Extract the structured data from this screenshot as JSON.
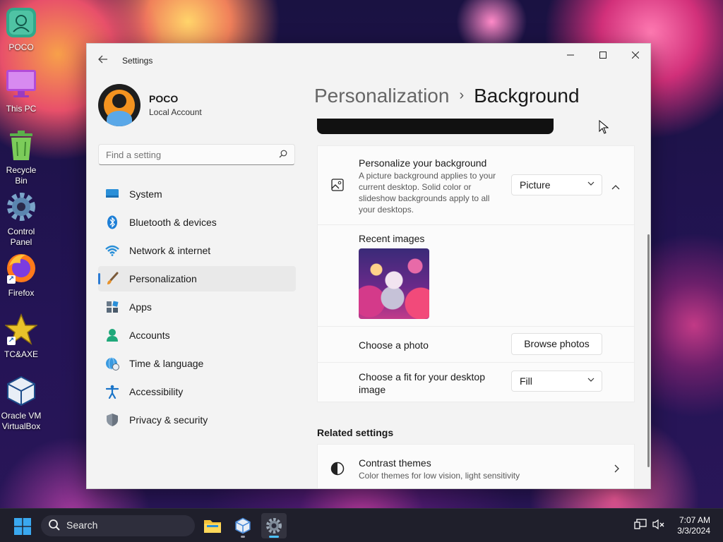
{
  "desktop": {
    "icons": [
      {
        "label": "POCO",
        "icon": "user-folder-icon"
      },
      {
        "label": "This PC",
        "icon": "monitor-icon"
      },
      {
        "label": "Recycle Bin",
        "icon": "recycle-bin-icon"
      },
      {
        "label": "Control Panel",
        "icon": "control-panel-icon"
      },
      {
        "label": "Firefox",
        "icon": "firefox-icon"
      },
      {
        "label": "TC&AXE",
        "icon": "star-icon"
      },
      {
        "label": "Oracle VM VirtualBox",
        "icon": "virtualbox-icon"
      }
    ]
  },
  "window": {
    "app_title": "Settings",
    "profile": {
      "name": "POCO",
      "account_type": "Local Account"
    },
    "search_placeholder": "Find a setting",
    "nav": [
      {
        "label": "System",
        "icon": "monitor-icon"
      },
      {
        "label": "Bluetooth & devices",
        "icon": "bluetooth-icon"
      },
      {
        "label": "Network & internet",
        "icon": "wifi-icon"
      },
      {
        "label": "Personalization",
        "icon": "brush-icon",
        "active": true
      },
      {
        "label": "Apps",
        "icon": "apps-icon"
      },
      {
        "label": "Accounts",
        "icon": "person-icon"
      },
      {
        "label": "Time & language",
        "icon": "globe-clock-icon"
      },
      {
        "label": "Accessibility",
        "icon": "accessibility-icon"
      },
      {
        "label": "Privacy & security",
        "icon": "shield-icon"
      }
    ],
    "breadcrumb": {
      "parent": "Personalization",
      "separator": "›",
      "current": "Background"
    },
    "background_card": {
      "title": "Personalize your background",
      "description": "A picture background applies to your current desktop. Solid color or slideshow backgrounds apply to all your desktops.",
      "selected": "Picture"
    },
    "recent_images_label": "Recent images",
    "choose_photo": {
      "label": "Choose a photo",
      "button": "Browse photos"
    },
    "fit": {
      "label": "Choose a fit for your desktop image",
      "selected": "Fill"
    },
    "related_settings_title": "Related settings",
    "contrast": {
      "title": "Contrast themes",
      "description": "Color themes for low vision, light sensitivity"
    }
  },
  "taskbar": {
    "search_label": "Search",
    "time": "7:07 AM",
    "date": "3/3/2024",
    "accent": "#4cc2ff"
  }
}
